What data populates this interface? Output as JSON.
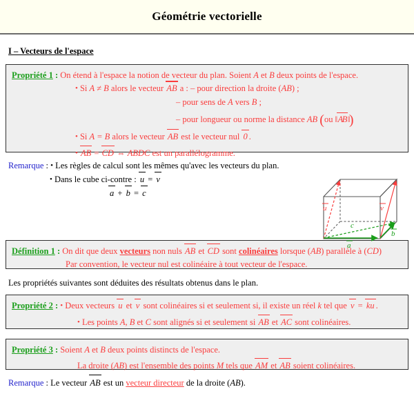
{
  "document": {
    "title": "Géométrie vectorielle",
    "section_heading": "I – Vecteurs de l'espace"
  },
  "colors": {
    "header_background": "#FFFFF0",
    "box_fill": "#EFEFEF",
    "box_border": "#303030",
    "label_green": "#1A9E1A",
    "body_red": "#FA3C3C",
    "remark_blue": "#2222CC",
    "cube_edge_gray": "#555555",
    "cube_vector_red": "#FA3C3C",
    "cube_vector_green": "#1A9E1A"
  },
  "propriete1": {
    "label": "Propriété 1",
    "colon": " : ",
    "intro_1": "On étend à l'espace la notion de vecteur du plan. Soient ",
    "intro_A": "A",
    "intro_et": " et ",
    "intro_B": "B",
    "intro_2": " deux points de l'espace.",
    "b1_si": "Si ",
    "b1_cond": "A ≠ B",
    "b1_alors": " alors le vecteur ",
    "b1_vec": "AB",
    "b1_a": " a : ",
    "b1_d1": "– pour direction la droite (",
    "b1_d1_AB": "AB",
    "b1_d1_end": ") ;",
    "b1_d2_a": "– pour sens de ",
    "b1_d2_A": "A",
    "b1_d2_vers": " vers ",
    "b1_d2_B": "B",
    "b1_d2_end": " ;",
    "b1_d3_a": "– pour longueur ou norme la distance ",
    "b1_d3_AB": "AB",
    "b1_d3_ou": "ou",
    "b1_d3_norm": "AB",
    "b2_si": "Si ",
    "b2_cond": "A = B",
    "b2_alors": " alors le vecteur ",
    "b2_vec": "AB",
    "b2_est": " est le vecteur nul ",
    "b2_zero": "0",
    "b2_end": ".",
    "b3_v1": "AB",
    "b3_eq": " = ",
    "b3_v2": "CD",
    "b3_iff": " ⇔ ",
    "b3_quad": "ABDC",
    "b3_end": " est un parallélogramme."
  },
  "remarque1": {
    "label": "Remarque",
    "colon": " : ",
    "bullet1": "Les règles de calcul sont les mêmes qu'avec les vecteurs du plan.",
    "bullet2": "Dans le cube ci-contre : ",
    "eq1_lhs": "u",
    "eq1_op": " = ",
    "eq1_rhs": "v",
    "eq2_a": "a",
    "eq2_plus": " + ",
    "eq2_b": "b",
    "eq2_eq": " = ",
    "eq2_c": "c"
  },
  "cube": {
    "vector_u": "u",
    "vector_v": "v",
    "vector_a": "a",
    "vector_b": "b",
    "vector_c": "c"
  },
  "definition1": {
    "label": "Définition 1",
    "colon": " : ",
    "l1_a": "On dit que deux ",
    "l1_vecteurs": "vecteurs",
    "l1_b": " non nuls ",
    "l1_v1": "AB",
    "l1_et": " et ",
    "l1_v2": "CD",
    "l1_c": " sont ",
    "l1_colineaires": "colinéaires",
    "l1_d": " lorsque (",
    "l1_AB": "AB",
    "l1_e": ") parallèle à (",
    "l1_CD": "CD",
    "l1_f": ")",
    "l2": "Par convention, le vecteur nul est colinéaire à tout vecteur de l'espace."
  },
  "intro_paragraph": "Les propriétés suivantes sont déduites des résultats obtenus dans le plan.",
  "propriete2": {
    "label": "Propriété 2",
    "colon": " : ",
    "b1_a": "Deux vecteurs ",
    "b1_u": "u",
    "b1_et": " et ",
    "b1_v": "v",
    "b1_b": " sont colinéaires si et seulement si, il existe un réel ",
    "b1_k": "k",
    "b1_c": " tel que ",
    "b1_v2": "v",
    "b1_eq": " = ",
    "b1_ku_k": "k",
    "b1_ku_u": "u",
    "b1_end": ".",
    "b2_a": "Les points ",
    "b2_A": "A",
    "b2_c1": ", ",
    "b2_B": "B",
    "b2_et": " et ",
    "b2_C": "C",
    "b2_b": " sont alignés si et seulement si ",
    "b2_v1": "AB",
    "b2_et2": " et ",
    "b2_v2": "AC",
    "b2_end": " sont colinéaires."
  },
  "propriete3": {
    "label": "Propriété 3",
    "colon": " : ",
    "l1_a": "Soient ",
    "l1_A": "A",
    "l1_et": " et ",
    "l1_B": "B",
    "l1_b": " deux points distincts de l'espace.",
    "l2_a": "La droite (",
    "l2_AB": "AB",
    "l2_b": ") est l'ensemble des points ",
    "l2_M": "M",
    "l2_c": " tels que ",
    "l2_v1": "AM",
    "l2_et": " et ",
    "l2_v2": "AB",
    "l2_end": " soient colinéaires."
  },
  "remarque2": {
    "label": "Remarque",
    "colon": " : ",
    "a": "Le vecteur ",
    "vec": "AB",
    "b": " est un ",
    "link": "vecteur directeur",
    "c": " de la droite (",
    "AB": "AB",
    "d": ")."
  }
}
